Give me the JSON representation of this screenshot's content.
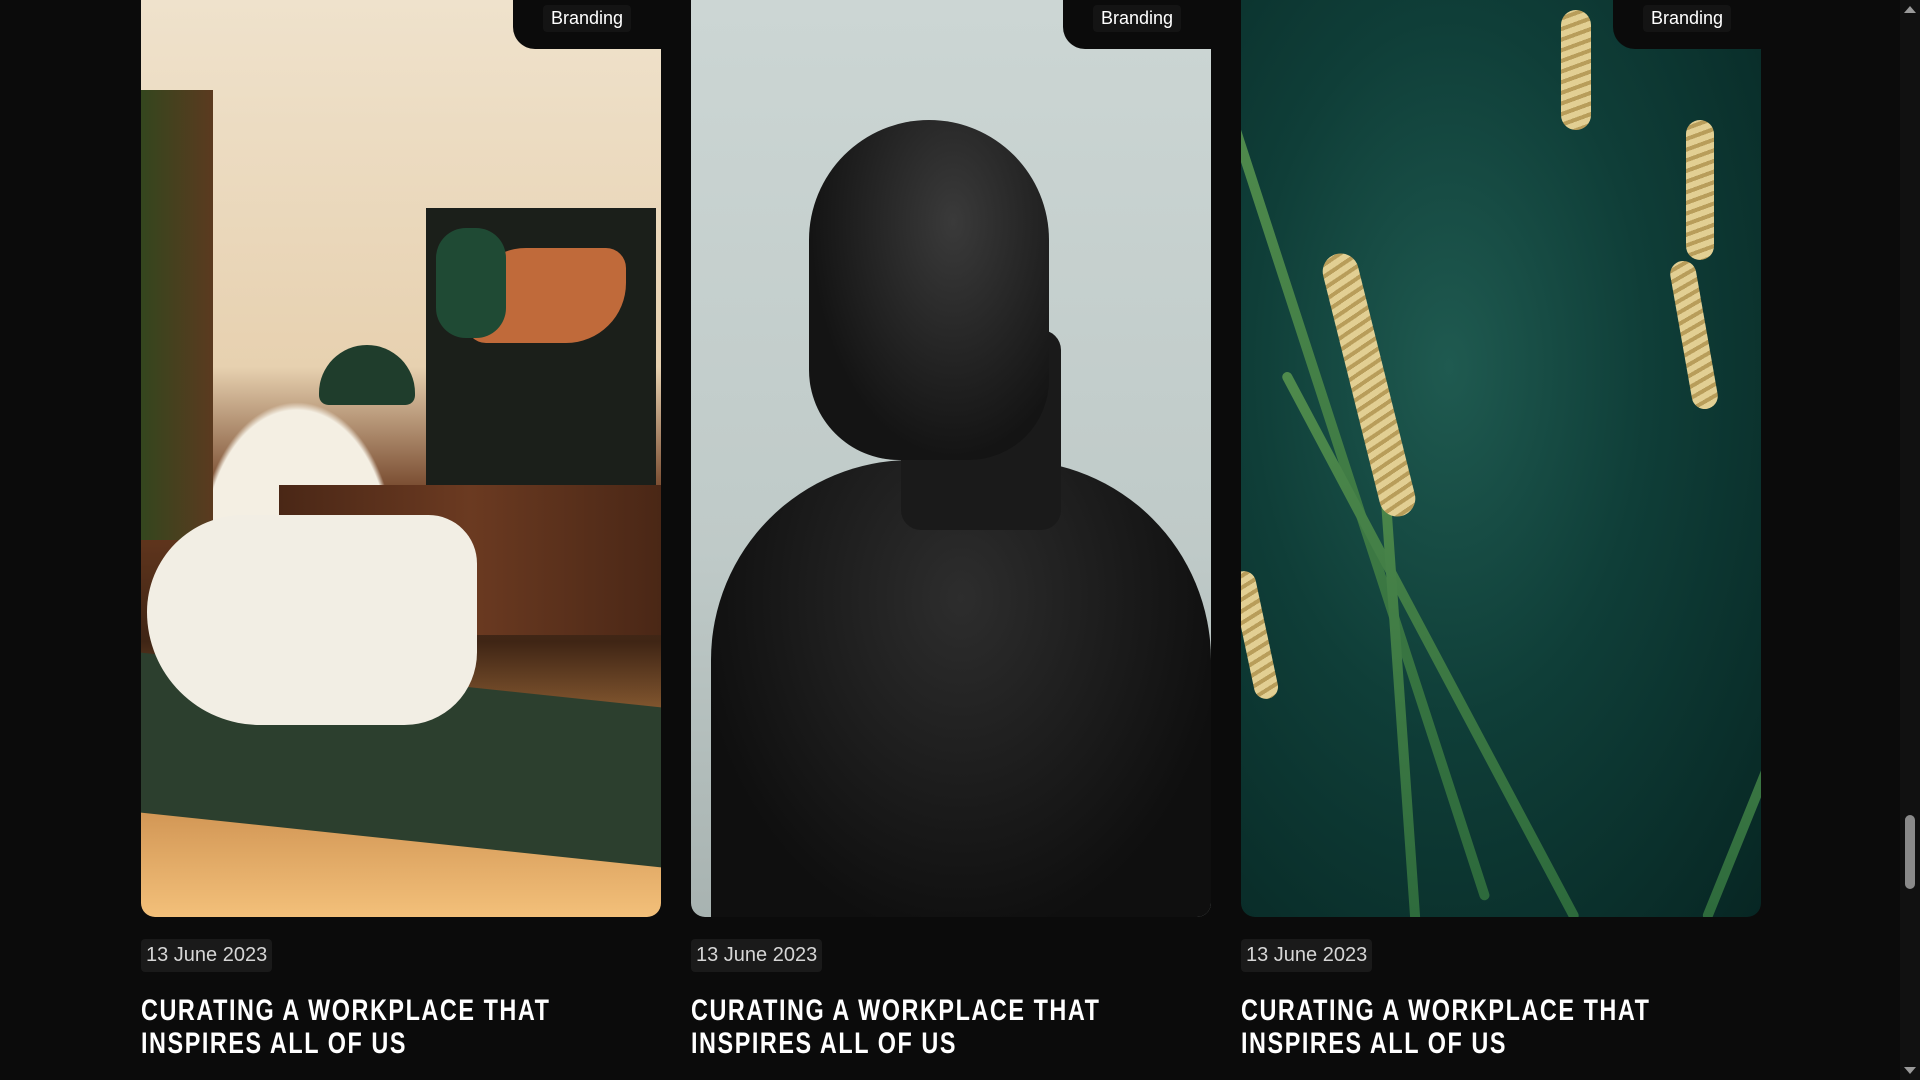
{
  "posts": [
    {
      "tag": "Branding",
      "date": "13 June 2023",
      "title": "CURATING A WORKPLACE THAT INSPIRES ALL OF US"
    },
    {
      "tag": "Branding",
      "date": "13 June 2023",
      "title": "CURATING A WORKPLACE THAT INSPIRES ALL OF US"
    },
    {
      "tag": "Branding",
      "date": "13 June 2023",
      "title": "CURATING A WORKPLACE THAT INSPIRES ALL OF US"
    }
  ],
  "colors": {
    "background": "#0b0b0b",
    "title_text": "#ffffff",
    "tag_bg": "#141414"
  },
  "icons": {
    "scroll_up": "scroll-up-arrow-icon",
    "scroll_down": "scroll-down-arrow-icon"
  }
}
